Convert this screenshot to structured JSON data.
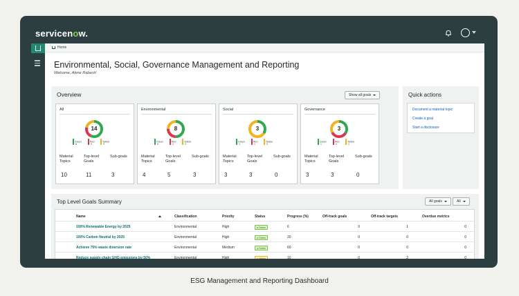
{
  "app": {
    "logo_pre": "servicen",
    "logo_o": "o",
    "logo_post": "w."
  },
  "breadcrumb": {
    "label": "Home"
  },
  "page": {
    "title": "Environmental, Social, Governance Management and Reporting",
    "welcome": "Welcome, Alene Rabeck!"
  },
  "overview": {
    "title": "Overview",
    "filter_button": "Show all goals",
    "metric_labels": [
      "Material Topics",
      "Top-level Goals",
      "Sub-goals"
    ],
    "cards": [
      {
        "title": "All",
        "total": "14",
        "green": "8",
        "red": "3",
        "yellow": "3",
        "green_label": "Green",
        "red_label": "Red",
        "yellow_label": "Yellow",
        "material_topics": "10",
        "top_level_goals": "11",
        "sub_goals": "3",
        "fractions": {
          "green": 0.57,
          "red": 0.21,
          "yellow": 0.22
        }
      },
      {
        "title": "Environmental",
        "total": "8",
        "green": "4",
        "red": "2",
        "yellow": "2",
        "green_label": "Green",
        "red_label": "Red",
        "yellow_label": "Yellow",
        "material_topics": "4",
        "top_level_goals": "5",
        "sub_goals": "3",
        "fractions": {
          "green": 0.5,
          "red": 0.25,
          "yellow": 0.25
        }
      },
      {
        "title": "Social",
        "total": "3",
        "green": "1",
        "red": "1",
        "yellow": "2",
        "green_label": "Green",
        "red_label": "Red",
        "yellow_label": "Yellow",
        "material_topics": "3",
        "top_level_goals": "3",
        "sub_goals": "0",
        "fractions": {
          "green": 0.34,
          "red": 0.0,
          "yellow": 0.66
        }
      },
      {
        "title": "Governance",
        "total": "3",
        "green": "1",
        "red": "1",
        "yellow": "1",
        "green_label": "Green",
        "red_label": "Red",
        "yellow_label": "Yellow",
        "material_topics": "3",
        "top_level_goals": "3",
        "sub_goals": "0",
        "fractions": {
          "green": 0.34,
          "red": 0.33,
          "yellow": 0.33
        }
      }
    ]
  },
  "quick_actions": {
    "title": "Quick actions",
    "links": [
      "Document a material topic",
      "Create a goal",
      "Start a disclosure"
    ]
  },
  "goals": {
    "title": "Top Level Goals Summary",
    "filter_goals": "All goals",
    "filter_all": "All",
    "columns": [
      "Name",
      "Classification",
      "Priority",
      "Status",
      "Progress (%)",
      "Off-track goals",
      "Off-track targets",
      "Overdue metrics"
    ],
    "rows": [
      {
        "name": "100% Renewable Energy by 2025",
        "classification": "Environmental",
        "priority": "High",
        "status": "Green",
        "progress": "6",
        "off_goals": "0",
        "off_targets": "1",
        "overdue": "0"
      },
      {
        "name": "100% Carbon Neutral by 2025",
        "classification": "Environmental",
        "priority": "High",
        "status": "Green",
        "progress": "20",
        "off_goals": "0",
        "off_targets": "0",
        "overdue": "0"
      },
      {
        "name": "Achieve 75% waste diversion rate",
        "classification": "Environmental",
        "priority": "Medium",
        "status": "Green",
        "progress": "60",
        "off_goals": "0",
        "off_targets": "0",
        "overdue": "0"
      },
      {
        "name": "Reduce supply chain GHG emissions by 50%",
        "classification": "Environmental",
        "priority": "High",
        "status": "Yellow",
        "progress": "10",
        "off_goals": "0",
        "off_targets": "2",
        "overdue": "0"
      }
    ]
  },
  "caption": "ESG Management and Reporting Dashboard",
  "colors": {
    "green": "#2fa84f",
    "red": "#d9364f",
    "yellow": "#f0b323",
    "accent": "#1f8a70"
  }
}
